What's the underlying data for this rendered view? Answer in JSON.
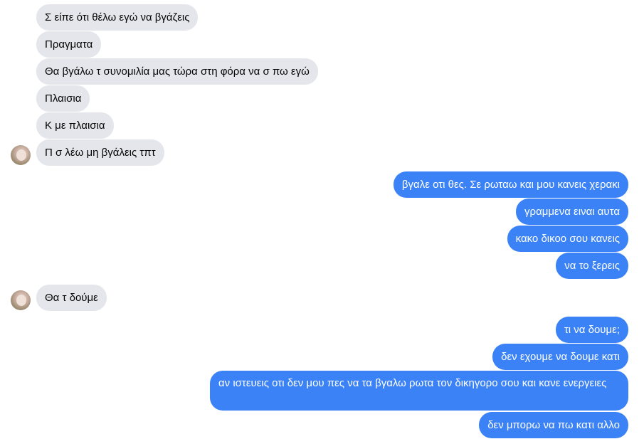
{
  "conversation": {
    "messages": [
      {
        "sender": "other",
        "text": "Σ είπε ότι θέλω εγώ να βγάζεις"
      },
      {
        "sender": "other",
        "text": "Πραγματα"
      },
      {
        "sender": "other",
        "text": "Θα βγάλω τ συνομιλία μας τώρα στη φόρα να σ πω εγώ"
      },
      {
        "sender": "other",
        "text": "Πλαισια"
      },
      {
        "sender": "other",
        "text": "Κ με πλαισια"
      },
      {
        "sender": "other",
        "text": "Π σ λέω μη βγάλεις τπτ"
      },
      {
        "sender": "me",
        "text": "βγαλε οτι θες. Σε ρωταω και μου κανεις χερακι"
      },
      {
        "sender": "me",
        "text": "γραμμενα ειναι αυτα"
      },
      {
        "sender": "me",
        "text": "κακο δικοο σου κανεις"
      },
      {
        "sender": "me",
        "text": "να το ξερεις"
      },
      {
        "sender": "other",
        "text": "Θα τ δούμε"
      },
      {
        "sender": "me",
        "text": "τι να δουμε;"
      },
      {
        "sender": "me",
        "text": "δεν εχουμε να δουμε κατι"
      },
      {
        "sender": "me",
        "text": "αν ιστευεις οτι δεν μου πες να τα βγαλω ρωτα τον δικηγορο σου και κανε ενεργειες"
      },
      {
        "sender": "me",
        "text": "δεν μπορω να πω κατι αλλο"
      }
    ]
  },
  "colors": {
    "incoming_bubble": "#e4e6eb",
    "outgoing_bubble": "#3b82f6",
    "outgoing_text": "#ffffff",
    "incoming_text": "#050505"
  }
}
